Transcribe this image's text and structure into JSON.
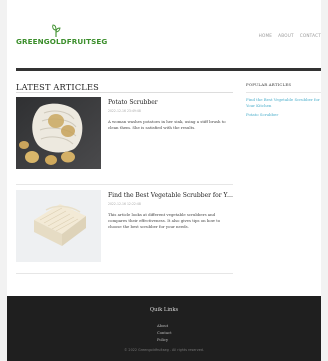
{
  "site": {
    "logo_text": "GREENGOLDFRUITSEG",
    "brand_color": "#3c8f2c"
  },
  "nav": {
    "items": [
      "HOME",
      "ABOUT",
      "CONTACT"
    ]
  },
  "main": {
    "section_title": "LATEST ARTICLES",
    "articles": [
      {
        "title": "Potato Scrubber",
        "date": "2022-12-16 23:49:48",
        "desc": "A woman washes potatoes in her sink, using a stiff brush to clean them. She is satisfied with the results."
      },
      {
        "title": "Find the Best Vegetable Scrubber for Your...",
        "date": "2022-12-16 12:22:48",
        "desc": "This article looks at different vegetable scrubbers and compares their effectiveness. It also gives tips on how to choose the best scrubber for your needs."
      }
    ]
  },
  "sidebar": {
    "title": "POPULAR ARTICLES",
    "links": [
      "Find the Best Vegetable Scrubber for Your Kitchen",
      "Potato Scrubber"
    ]
  },
  "footer": {
    "title": "Quik Links",
    "links": [
      "About",
      "Contact",
      "Policy"
    ],
    "copyright": "© 2022 Greengoldfruitseg . All rights reserved."
  }
}
